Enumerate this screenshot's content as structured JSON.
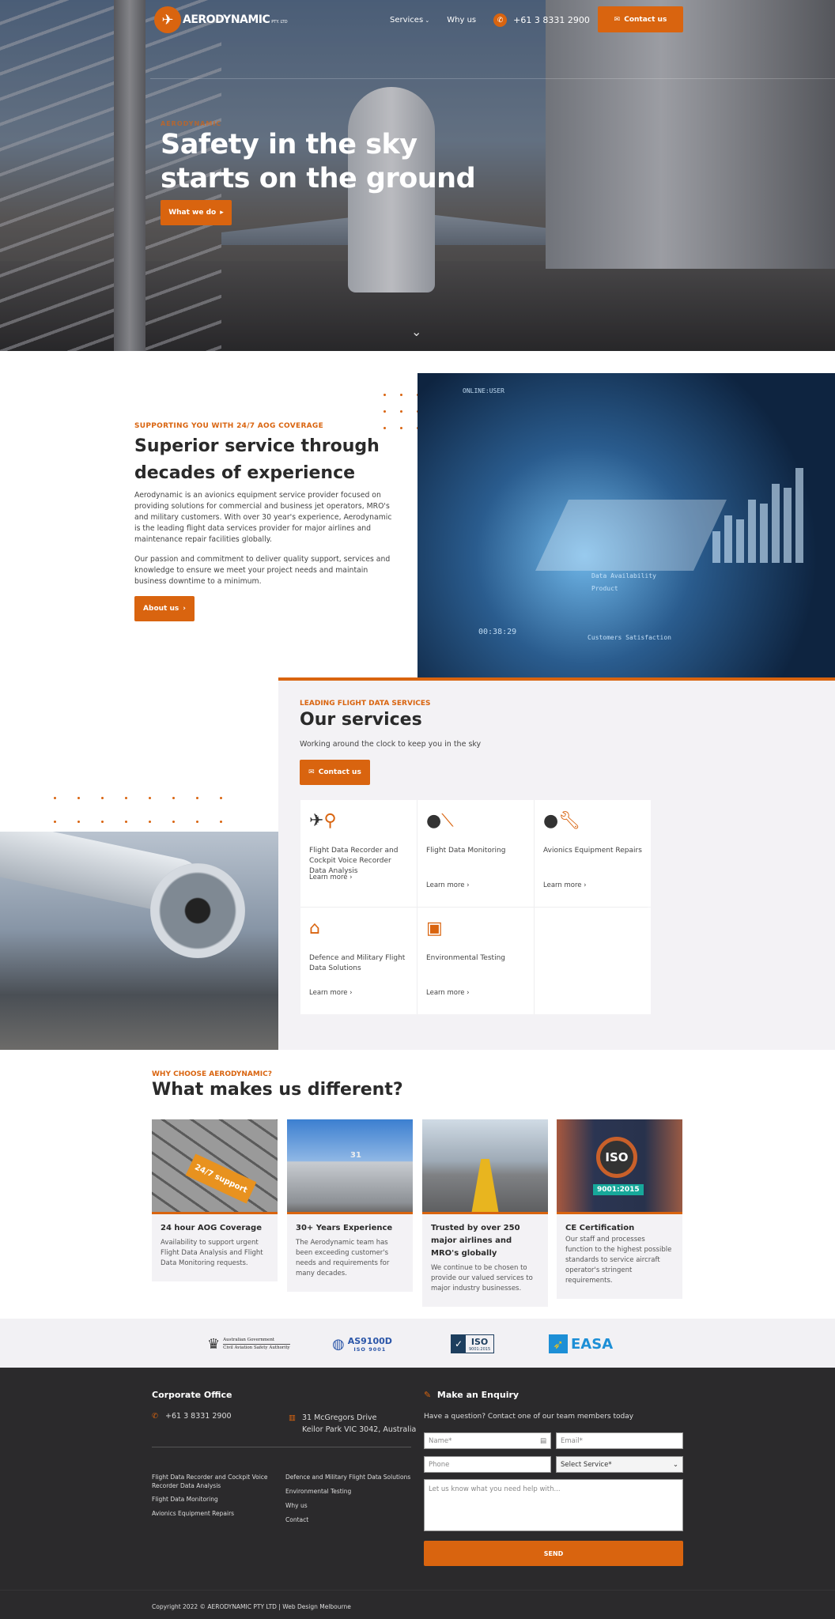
{
  "header": {
    "logo_text": "AERODYNAMIC",
    "logo_suffix": "PTY. LTD",
    "nav": [
      {
        "label": "Services",
        "has_dropdown": true
      },
      {
        "label": "Why us"
      }
    ],
    "phone": "+61 3 8331 2900",
    "contact_label": "Contact us"
  },
  "hero": {
    "eyebrow": "AERODYNAMIC",
    "title_line1": "Safety in the sky",
    "title_line2": "starts on the ground",
    "button": "What we do"
  },
  "about": {
    "eyebrow": "SUPPORTING YOU WITH 24/7 AOG COVERAGE",
    "title": "Superior service through decades of experience",
    "p1": "Aerodynamic is an avionics equipment service provider focused on providing solutions for commercial and business jet operators, MRO's and military customers. With over 30 year's experience, Aerodynamic is the leading flight data services provider for major airlines and maintenance repair facilities globally.",
    "p2": "Our passion and commitment to deliver quality support, services and knowledge to ensure we meet your project needs and maintain business downtime to a minimum.",
    "button": "About us",
    "image_text": {
      "a": "ONLINE:USER",
      "b": "Data Availability",
      "c": "Product",
      "d": "Customers Satisfaction",
      "e": "00:38:29"
    }
  },
  "services": {
    "eyebrow": "LEADING FLIGHT DATA SERVICES",
    "title": "Our services",
    "subtitle": "Working around the clock to keep you in the sky",
    "button": "Contact us",
    "items": [
      {
        "name": "Flight Data Recorder and Cockpit Voice Recorder Data Analysis",
        "link": "Learn more",
        "icon": "plane-search-icon"
      },
      {
        "name": "Flight Data Monitoring",
        "link": "Learn more",
        "icon": "magnifier-plane-icon"
      },
      {
        "name": "Avionics Equipment Repairs",
        "link": "Learn more",
        "icon": "plane-wrench-icon"
      },
      {
        "name": "Defence and Military Flight Data Solutions",
        "link": "Learn more",
        "icon": "hangar-plane-icon"
      },
      {
        "name": "Environmental Testing",
        "link": "Learn more",
        "icon": "stacked-plane-icon"
      }
    ]
  },
  "why": {
    "eyebrow": "WHY CHOOSE AERODYNAMIC?",
    "title": "What makes us different?",
    "cards": [
      {
        "title": "24 hour AOG Coverage",
        "text": "Availability to support urgent Flight Data Analysis and Flight Data Monitoring requests.",
        "image_text": "24/7 support"
      },
      {
        "title": "30+ Years Experience",
        "text": "The Aerodynamic team has been exceeding customer's needs and requirements for many decades.",
        "image_text": "31"
      },
      {
        "title": "Trusted by over 250 major airlines and MRO's globally",
        "text": "We continue to be chosen to provide our valued services to major industry businesses."
      },
      {
        "title": "CE Certification",
        "text": "Our staff and processes function to the highest possible standards to service aircraft operator's stringent requirements.",
        "image_text": "ISO",
        "image_badge": "9001:2015"
      }
    ]
  },
  "logos": [
    {
      "line1": "Australian Government",
      "line2": "Civil Aviation Safety Authority"
    },
    {
      "line1": "AS9100D",
      "line2": "ISO 9001"
    },
    {
      "line1": "ISO",
      "line2": "9001:2015"
    },
    {
      "line1": "EASA"
    }
  ],
  "footer": {
    "office_title": "Corporate Office",
    "phone": "+61 3 8331 2900",
    "address1": "31 McGregors Drive",
    "address2": "Keilor Park VIC 3042, Australia",
    "links_col1": [
      "Flight Data Recorder and Cockpit Voice Recorder Data Analysis",
      "Flight Data Monitoring",
      "Avionics Equipment Repairs"
    ],
    "links_col2": [
      "Defence and Military Flight Data Solutions",
      "Environmental Testing",
      "Why us",
      "Contact"
    ],
    "enquiry_title": "Make an Enquiry",
    "enquiry_sub": "Have a question? Contact one of our team members today",
    "form": {
      "name": "Name*",
      "email": "Email*",
      "phone": "Phone",
      "service": "Select Service*",
      "message": "Let us know what you need help with...",
      "send": "SEND"
    },
    "copyright": "Copyright 2022 © AERODYNAMIC PTY LTD | Web Design Melbourne"
  },
  "colors": {
    "accent": "#d9640f",
    "footer_bg": "#2b2a2c",
    "section_bg": "#f3f2f5"
  }
}
